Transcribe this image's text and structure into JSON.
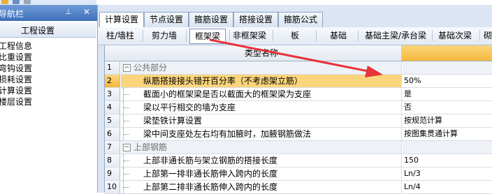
{
  "nav": {
    "title": "导航栏",
    "pin_icon": "pin-icon",
    "close_icon": "close-icon",
    "section": "工程设置",
    "items": [
      "工程信息",
      "比重设置",
      "弯钩设置",
      "损耗设置",
      "计算设置",
      "楼层设置"
    ]
  },
  "tabs": [
    {
      "label": "计算设置",
      "active": true
    },
    {
      "label": "节点设置",
      "active": false
    },
    {
      "label": "箍筋设置",
      "active": false
    },
    {
      "label": "搭接设置",
      "active": false
    },
    {
      "label": "箍筋公式",
      "active": false
    }
  ],
  "subtabs": [
    {
      "label": "柱/墙柱",
      "active": false
    },
    {
      "label": "剪力墙",
      "active": false
    },
    {
      "label": "框架梁",
      "active": true
    },
    {
      "label": "非框架梁",
      "active": false
    },
    {
      "label": "板",
      "active": false
    },
    {
      "label": "基础",
      "active": false
    },
    {
      "label": "基础主梁/承台梁",
      "active": false
    },
    {
      "label": "基础次梁",
      "active": false
    },
    {
      "label": "砌",
      "active": false
    }
  ],
  "grid": {
    "header_name": "类型名称",
    "rows": [
      {
        "num": "1",
        "name": "公共部分",
        "value": "",
        "group": true
      },
      {
        "num": "2",
        "name": "纵筋搭接接头错开百分率（不考虑架立筋）",
        "value": "50%",
        "selected": true
      },
      {
        "num": "3",
        "name": "截面小的框架梁是否以截面大的框架梁为支座",
        "value": "是"
      },
      {
        "num": "4",
        "name": "梁以平行相交的墙为支座",
        "value": "否"
      },
      {
        "num": "5",
        "name": "梁垫铁计算设置",
        "value": "按规范计算"
      },
      {
        "num": "6",
        "name": "梁中间支座处左右均有加腋时，加腋钢筋做法",
        "value": "按图集贯通计算"
      },
      {
        "num": "7",
        "name": "上部钢筋",
        "value": "",
        "group": true
      },
      {
        "num": "8",
        "name": "上部非通长筋与架立钢筋的搭接长度",
        "value": "150"
      },
      {
        "num": "9",
        "name": "上部第一排非通长筋伸入跨内的长度",
        "value": "Ln/3"
      },
      {
        "num": "10",
        "name": "上部第二排非通长筋伸入跨内的长度",
        "value": "Ln/4"
      }
    ]
  },
  "colors": {
    "accent": "#f4b73c",
    "annotation": "#e8323c",
    "nav_header": "#3d6fb8"
  }
}
